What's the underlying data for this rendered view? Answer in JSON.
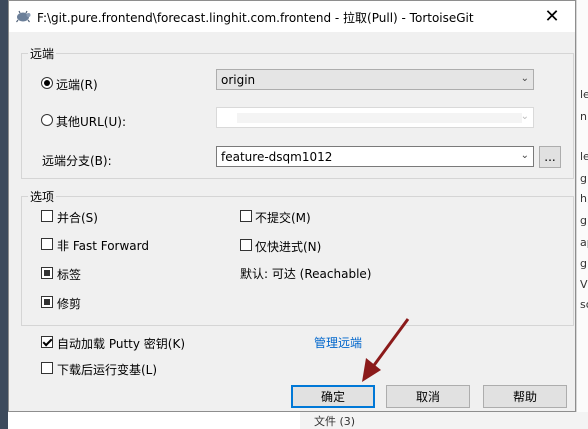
{
  "window": {
    "title": "F:\\git.pure.frontend\\forecast.linghit.com.frontend - 拉取(Pull) - TortoiseGit",
    "close_glyph": "✕"
  },
  "background_window": {
    "text_fragments": [
      "le",
      "n",
      "ler",
      "g",
      "h,",
      "g",
      "ap",
      "gi",
      "Vi",
      "so"
    ],
    "bottom_text": "文件 (3)"
  },
  "remote_group": {
    "legend": "远端",
    "remote_radio_label": "远端(R)",
    "remote_selected": true,
    "remote_value": "origin",
    "other_url_label": "其他URL(U):",
    "other_url_selected": false,
    "other_url_value": "",
    "remote_branch_label": "远端分支(B):",
    "remote_branch_value": "feature-dsqm1012",
    "browse_label": "..."
  },
  "options_group": {
    "legend": "选项",
    "squash_label": "并合(S)",
    "squash_state": "unchecked",
    "no_fast_forward_label": "非 Fast Forward",
    "no_fast_forward_state": "unchecked",
    "tags_label": "标签",
    "tags_state": "indeterminate",
    "prune_label": "修剪",
    "prune_state": "indeterminate",
    "no_commit_label": "不提交(M)",
    "no_commit_state": "unchecked",
    "ff_only_label": "仅快进式(N)",
    "ff_only_state": "unchecked",
    "default_note": "默认: 可达 (Reachable)"
  },
  "autoload_putty_label": "自动加载 Putty 密钥(K)",
  "autoload_putty_checked": true,
  "rebase_after_label": "下载后运行变基(L)",
  "rebase_after_checked": false,
  "manage_remotes_link": "管理远端",
  "buttons": {
    "ok": "确定",
    "cancel": "取消",
    "help": "帮助"
  },
  "colors": {
    "link": "#0066cc",
    "default_button_border": "#0078d7",
    "annotation_arrow": "#8b1a1a"
  }
}
